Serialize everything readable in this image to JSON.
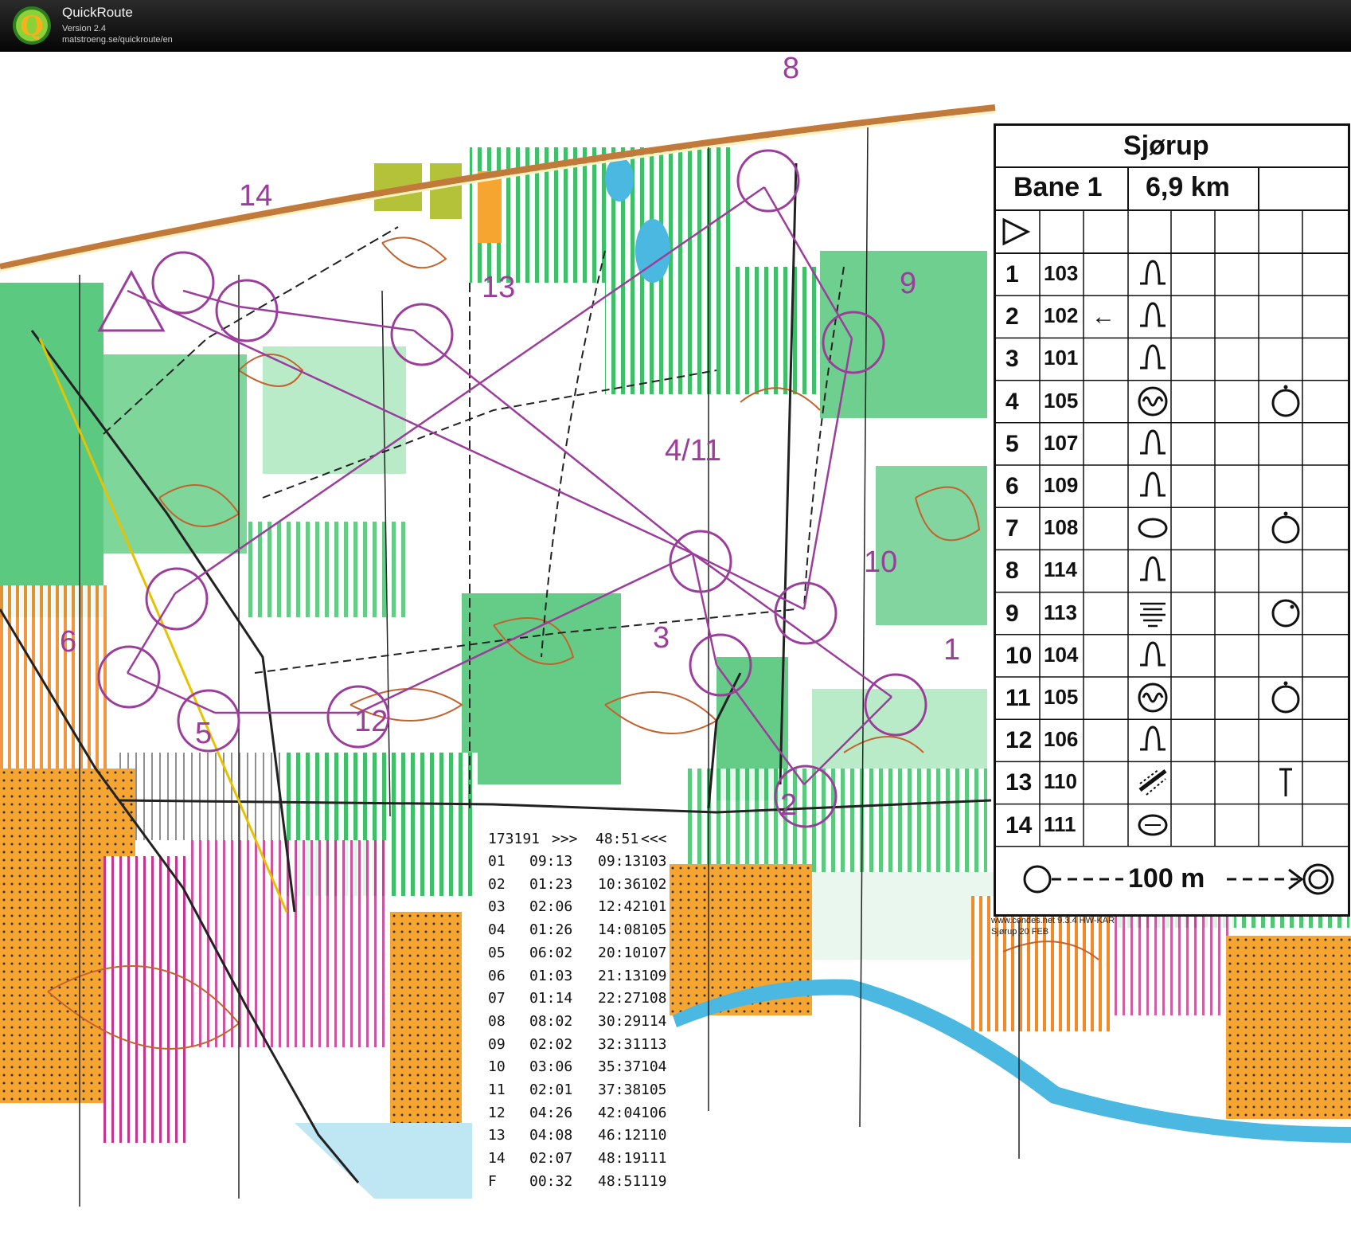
{
  "app": {
    "title": "QuickRoute",
    "version": "Version 2.4",
    "url": "matstroeng.se/quickroute/en",
    "logo_letter": "Q"
  },
  "map_labels": [
    "8",
    "14",
    "13",
    "9",
    "4/11",
    "10",
    "3",
    "1",
    "6",
    "5",
    "12",
    "2"
  ],
  "description_sheet": {
    "event": "Sjørup",
    "course": "Bane 1",
    "length": "6,9 km",
    "controls": [
      {
        "num": "1",
        "code": "103",
        "direction": "",
        "feature": "knoll-icon",
        "location": ""
      },
      {
        "num": "2",
        "code": "102",
        "direction": "←",
        "feature": "knoll-icon",
        "location": ""
      },
      {
        "num": "3",
        "code": "101",
        "direction": "",
        "feature": "knoll-icon",
        "location": ""
      },
      {
        "num": "4",
        "code": "105",
        "direction": "",
        "feature": "thicket-icon",
        "location": "top-icon"
      },
      {
        "num": "5",
        "code": "107",
        "direction": "",
        "feature": "knoll-icon",
        "location": ""
      },
      {
        "num": "6",
        "code": "109",
        "direction": "",
        "feature": "knoll-icon",
        "location": ""
      },
      {
        "num": "7",
        "code": "108",
        "direction": "",
        "feature": "clearing-icon",
        "location": "top-icon"
      },
      {
        "num": "8",
        "code": "114",
        "direction": "",
        "feature": "knoll-icon",
        "location": ""
      },
      {
        "num": "9",
        "code": "113",
        "direction": "",
        "feature": "marsh-icon",
        "location": "corner-icon"
      },
      {
        "num": "10",
        "code": "104",
        "direction": "",
        "feature": "knoll-icon",
        "location": ""
      },
      {
        "num": "11",
        "code": "105",
        "direction": "",
        "feature": "thicket-icon",
        "location": "top-icon"
      },
      {
        "num": "12",
        "code": "106",
        "direction": "",
        "feature": "knoll-icon",
        "location": ""
      },
      {
        "num": "13",
        "code": "110",
        "direction": "",
        "feature": "ditch-icon",
        "location": "end-icon"
      },
      {
        "num": "14",
        "code": "111",
        "direction": "",
        "feature": "depression-icon",
        "location": ""
      }
    ],
    "finish": "100 m",
    "credit_line1": "www.condes.net 9.3.4 HW-KAR",
    "credit_line2": "Sjørup 20 FEB"
  },
  "splits": {
    "header": {
      "id": "173191",
      "arrow_right": ">>>",
      "total": "48:51",
      "arrow_left": "<<<"
    },
    "rows": [
      {
        "leg": "01",
        "split": "09:13",
        "cumulative": "09:13",
        "code": "103"
      },
      {
        "leg": "02",
        "split": "01:23",
        "cumulative": "10:36",
        "code": "102"
      },
      {
        "leg": "03",
        "split": "02:06",
        "cumulative": "12:42",
        "code": "101"
      },
      {
        "leg": "04",
        "split": "01:26",
        "cumulative": "14:08",
        "code": "105"
      },
      {
        "leg": "05",
        "split": "06:02",
        "cumulative": "20:10",
        "code": "107"
      },
      {
        "leg": "06",
        "split": "01:03",
        "cumulative": "21:13",
        "code": "109"
      },
      {
        "leg": "07",
        "split": "01:14",
        "cumulative": "22:27",
        "code": "108"
      },
      {
        "leg": "08",
        "split": "08:02",
        "cumulative": "30:29",
        "code": "114"
      },
      {
        "leg": "09",
        "split": "02:02",
        "cumulative": "32:31",
        "code": "113"
      },
      {
        "leg": "10",
        "split": "03:06",
        "cumulative": "35:37",
        "code": "104"
      },
      {
        "leg": "11",
        "split": "02:01",
        "cumulative": "37:38",
        "code": "105"
      },
      {
        "leg": "12",
        "split": "04:26",
        "cumulative": "42:04",
        "code": "106"
      },
      {
        "leg": "13",
        "split": "04:08",
        "cumulative": "46:12",
        "code": "110"
      },
      {
        "leg": "14",
        "split": "02:07",
        "cumulative": "48:19",
        "code": "111"
      },
      {
        "leg": "F",
        "split": "00:32",
        "cumulative": "48:51",
        "code": "119"
      }
    ]
  },
  "colors": {
    "course": "#9b3d9b",
    "forest_green": "#3fbf6a",
    "open_yellow": "#f6a531",
    "water": "#4ab8e0",
    "contour": "#c4622d"
  }
}
